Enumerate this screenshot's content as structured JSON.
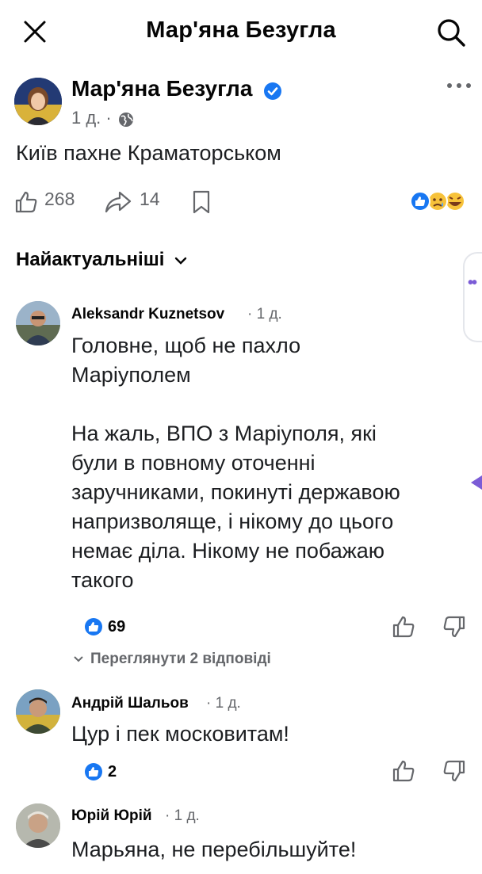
{
  "header": {
    "title": "Мар'яна Безугла",
    "close_icon": "close-icon",
    "search_icon": "search-icon"
  },
  "post": {
    "author": "Мар'яна Безугла",
    "meta": "1 д. ·",
    "text": "Київ пахне Краматорськом",
    "likes": "268",
    "shares": "14",
    "reactions": [
      "like",
      "sad",
      "haha"
    ]
  },
  "comments_sort": {
    "label": "Найактуальніші"
  },
  "comments": [
    {
      "author": "Aleksandr Kuznetsov",
      "time": "· 1 д.",
      "text": "Головне, щоб не пахло\nМаріуполем\n\nНа жаль, ВПО з Маріуполя, які\nбули в повному оточенні\nзаручниками, покинуті державою\nнапризволяще, і нікому до цього\nнемає діла. Нікому не побажаю\nтакого",
      "likes": "69",
      "view_replies": "Переглянути 2 відповіді"
    },
    {
      "author": "Андрій Шальов",
      "time": "· 1 д.",
      "text": "Цур і пек московитам!",
      "likes": "2"
    },
    {
      "author": "Юрій Юрій",
      "time": "· 1 д.",
      "text": "Марьяна, не перебільшуйте!"
    }
  ],
  "colors": {
    "fb_blue": "#1877f2",
    "secondary_text": "#65676b",
    "side_purple": "#7b5cd6"
  }
}
